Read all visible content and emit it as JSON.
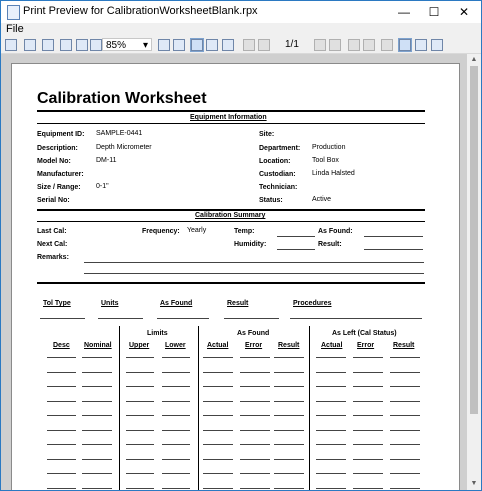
{
  "window": {
    "title": "Print Preview for CalibrationWorksheetBlank.rpx",
    "minimize": "—",
    "maximize": "☐",
    "close": "✕"
  },
  "menu": {
    "file": "File"
  },
  "toolbar": {
    "zoom": "85%",
    "zoom_arrow": "▾",
    "page_indicator": "1/1"
  },
  "report": {
    "title": "Calibration Worksheet",
    "equipment_header": "Equipment Information",
    "equipment": {
      "equipment_id_label": "Equipment ID:",
      "equipment_id": "SAMPLE-0441",
      "description_label": "Description:",
      "description": "Depth Micrometer",
      "model_label": "Model No:",
      "model": "DM-11",
      "manufacturer_label": "Manufacturer:",
      "size_label": "Size / Range:",
      "size": "0-1\"",
      "serial_label": "Serial No:",
      "site_label": "Site:",
      "department_label": "Department:",
      "department": "Production",
      "location_label": "Location:",
      "location": "Tool Box",
      "custodian_label": "Custodian:",
      "custodian": "Linda Halsted",
      "technician_label": "Technician:",
      "status_label": "Status:",
      "status": "Active"
    },
    "summary_header": "Calibration Summary",
    "summary": {
      "last_cal_label": "Last Cal:",
      "next_cal_label": "Next Cal:",
      "remarks_label": "Remarks:",
      "frequency_label": "Frequency:",
      "frequency": "Yearly",
      "temp_label": "Temp:",
      "humidity_label": "Humidity:",
      "as_found_label": "As Found:",
      "result_label": "Result:"
    },
    "tol_headers": {
      "tol_type": "Tol Type",
      "units": "Units",
      "as_found": "As Found",
      "result": "Result",
      "procedures": "Procedures"
    },
    "table": {
      "limits": "Limits",
      "as_found": "As Found",
      "as_left": "As Left (Cal Status)",
      "desc": "Desc",
      "nominal": "Nominal",
      "upper": "Upper",
      "lower": "Lower",
      "af_actual": "Actual",
      "af_error": "Error",
      "af_result": "Result",
      "al_actual": "Actual",
      "al_error": "Error",
      "al_result": "Result"
    }
  }
}
